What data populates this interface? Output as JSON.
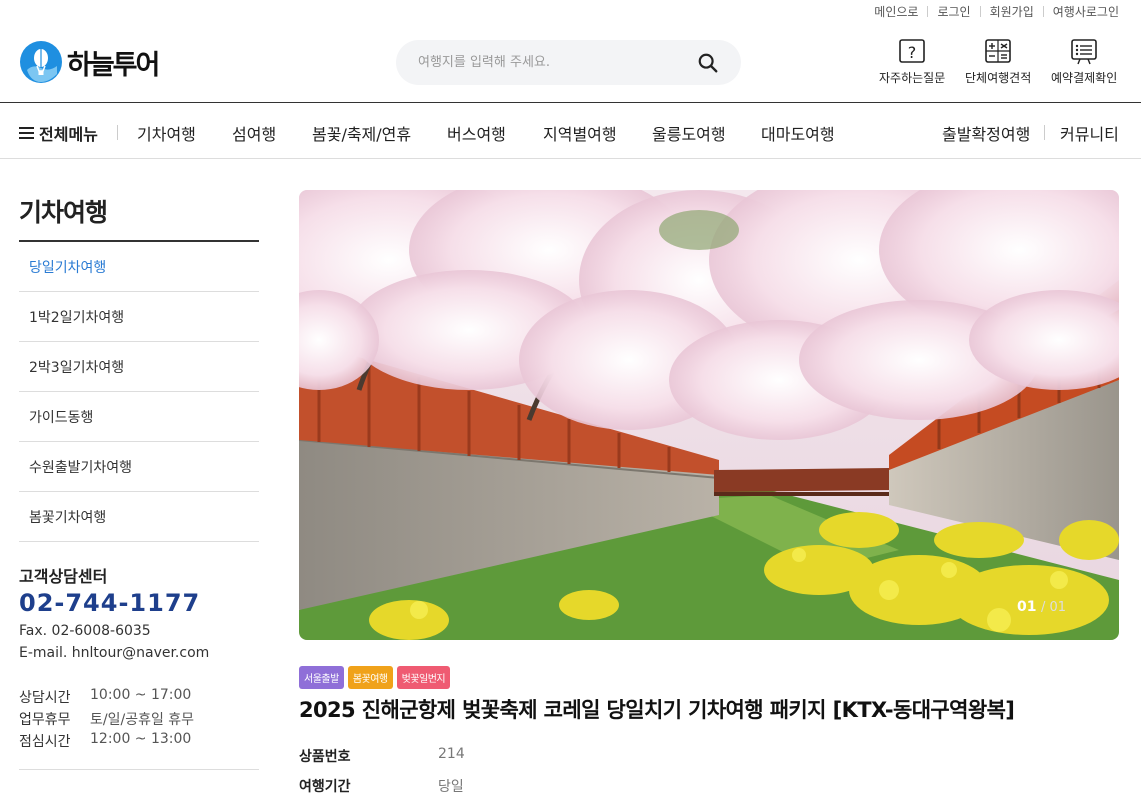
{
  "util_links": [
    "메인으로",
    "로그인",
    "회원가입",
    "여행사로그인"
  ],
  "logo": {
    "text": "하늘투어"
  },
  "search": {
    "placeholder": "여행지를 입력해 주세요."
  },
  "quick_links": [
    {
      "label": "자주하는질문",
      "icon": "question-icon"
    },
    {
      "label": "단체여행견적",
      "icon": "calculator-icon"
    },
    {
      "label": "예약결제확인",
      "icon": "list-board-icon"
    }
  ],
  "gnb": {
    "all_menu": "전체메뉴",
    "items": [
      "기차여행",
      "섬여행",
      "봄꽃/축제/연휴",
      "버스여행",
      "지역별여행",
      "울릉도여행",
      "대마도여행"
    ],
    "right_items": [
      "출발확정여행",
      "커뮤니티"
    ]
  },
  "sidebar": {
    "title": "기차여행",
    "items": [
      {
        "label": "당일기차여행",
        "active": true
      },
      {
        "label": "1박2일기차여행"
      },
      {
        "label": "2박3일기차여행"
      },
      {
        "label": "가이드동행"
      },
      {
        "label": "수원출발기차여행"
      },
      {
        "label": "봄꽃기차여행"
      }
    ]
  },
  "customer_center": {
    "title": "고객상담센터",
    "phone": "02-744-1177",
    "fax": "Fax. 02-6008-6035",
    "email": "E-mail. hnltour@naver.com",
    "hours": [
      {
        "label": "상담시간",
        "value": "10:00 ~ 17:00"
      },
      {
        "label": "업무휴무",
        "value": "토/일/공휴일 휴무"
      },
      {
        "label": "점심시간",
        "value": "12:00 ~ 13:00"
      }
    ]
  },
  "hero": {
    "current": "01",
    "total": "01"
  },
  "product": {
    "tags": [
      {
        "label": "서울출발",
        "color": "#8f6fd8"
      },
      {
        "label": "봄꽃여행",
        "color": "#f0a21a"
      },
      {
        "label": "벚꽃일번지",
        "color": "#ef5b72"
      }
    ],
    "title": "2025 진해군항제 벚꽃축제 코레일 당일치기 기차여행 패키지 [KTX-동대구역왕복]",
    "info": [
      {
        "label": "상품번호",
        "value": "214"
      },
      {
        "label": "여행기간",
        "value": "당일"
      }
    ]
  },
  "colors": {
    "accent_blue": "#2a7bd3",
    "phone_navy": "#1e3f8c"
  }
}
